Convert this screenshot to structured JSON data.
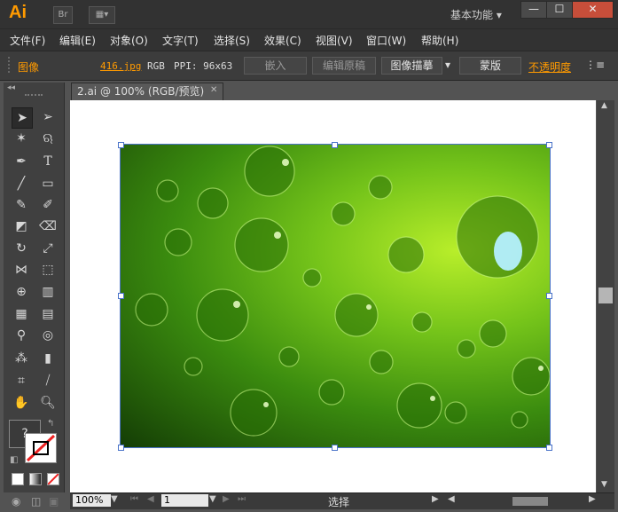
{
  "app": {
    "logo": "Ai",
    "bridge_label": "Br",
    "workspace": "基本功能",
    "win_minimize": "—",
    "win_maximize": "☐",
    "win_close": "✕"
  },
  "menu": [
    "文件(F)",
    "编辑(E)",
    "对象(O)",
    "文字(T)",
    "选择(S)",
    "效果(C)",
    "视图(V)",
    "窗口(W)",
    "帮助(H)"
  ],
  "control": {
    "kind": "图像",
    "filename": "416.jpg",
    "mode": "RGB",
    "ppi_label": "PPI: 96x63",
    "embed": "嵌入",
    "edit_original": "编辑原稿",
    "image_trace": "图像描摹",
    "mask": "蒙版",
    "opacity": "不透明度"
  },
  "document": {
    "tab_title": "2.ai @ 100% (RGB/预览)"
  },
  "status": {
    "zoom": "100%",
    "page": "1",
    "tool": "选择"
  },
  "colors": {
    "accent": "#ff9a00",
    "selection": "#4a73c9"
  }
}
